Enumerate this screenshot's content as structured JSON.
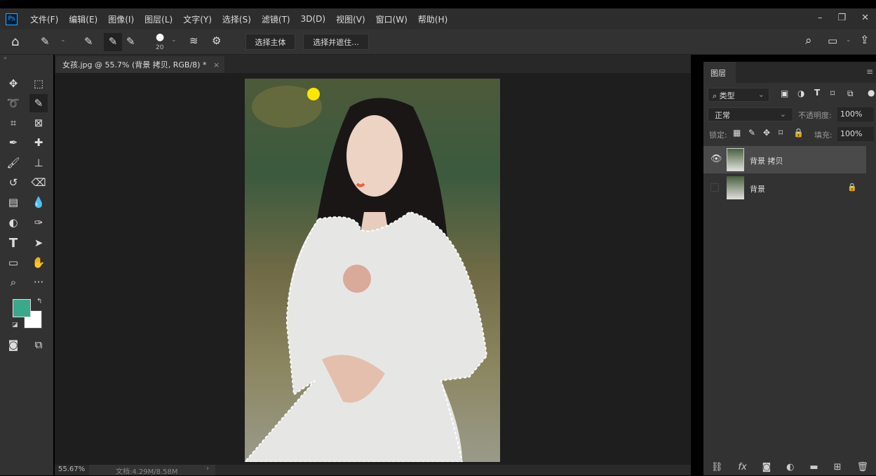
{
  "menubar": {
    "logo": "Ps",
    "items": [
      "文件(F)",
      "编辑(E)",
      "图像(I)",
      "图层(L)",
      "文字(Y)",
      "选择(S)",
      "滤镜(T)",
      "3D(D)",
      "视图(V)",
      "窗口(W)",
      "帮助(H)"
    ]
  },
  "options": {
    "brush_size": "20",
    "select_subject": "选择主体",
    "select_and_mask": "选择并遮住..."
  },
  "document": {
    "tab_title": "女孩.jpg @ 55.7% (背景 拷贝, RGB/8) *",
    "close": "×"
  },
  "status": {
    "zoom": "55.67%",
    "doc_size": "文档:4.29M/8.58M",
    "arrow": "›"
  },
  "colors": {
    "foreground": "#3aa98b",
    "background": "#ffffff"
  },
  "layers_panel": {
    "title": "图层",
    "filter_kind": "类型",
    "blend_mode": "正常",
    "opacity_label": "不透明度:",
    "opacity": "100%",
    "lock_label": "锁定:",
    "fill_label": "填充:",
    "fill": "100%",
    "layers": [
      {
        "name": "背景 拷贝",
        "visible": true,
        "selected": true,
        "locked": false
      },
      {
        "name": "背景",
        "visible": false,
        "selected": false,
        "locked": true
      }
    ]
  }
}
